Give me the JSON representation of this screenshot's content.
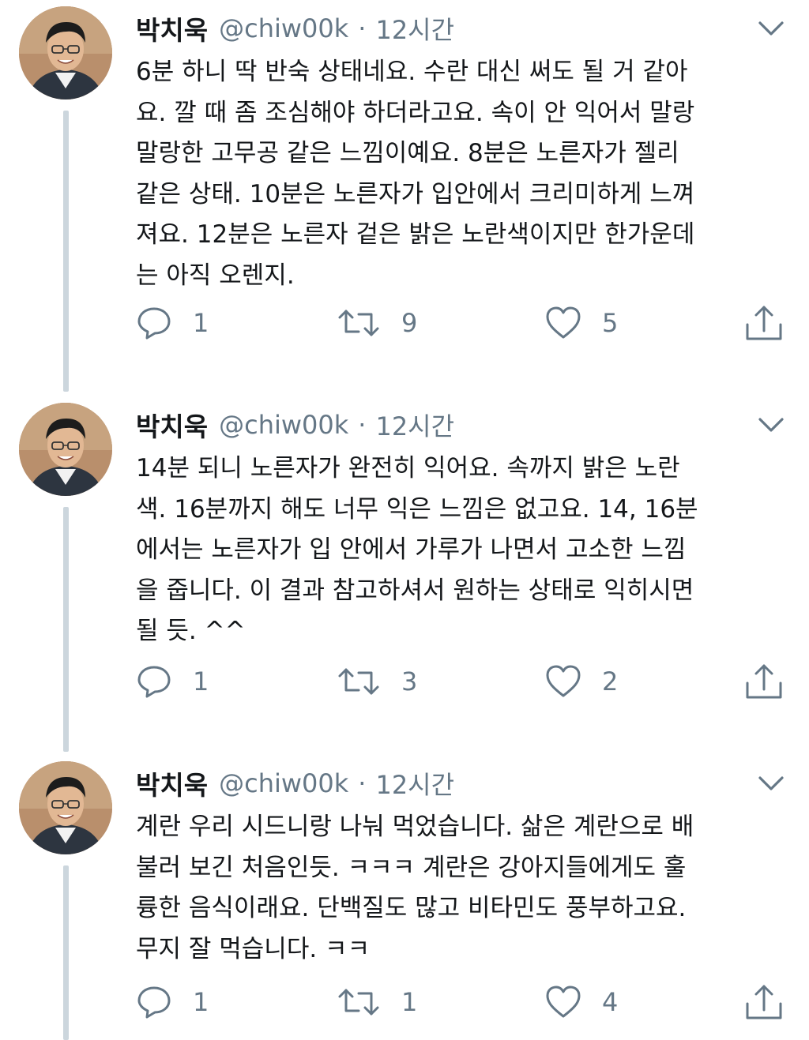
{
  "tweets": [
    {
      "author_name": "박치욱",
      "handle": "@chiw00k",
      "separator": "·",
      "time": "12시간",
      "text": "6분 하니 딱 반숙 상태네요. 수란 대신 써도 될 거 같아\n요. 깔 때 좀 조심해야 하더라고요. 속이 안 익어서 말랑\n말랑한 고무공 같은 느낌이예요. 8분은 노른자가 젤리\n같은 상태. 10분은 노른자가 입안에서 크리미하게 느껴\n져요. 12분은 노른자 겉은 밝은 노란색이지만 한가운데\n는 아직 오렌지.",
      "replies": "1",
      "retweets": "9",
      "likes": "5"
    },
    {
      "author_name": "박치욱",
      "handle": "@chiw00k",
      "separator": "·",
      "time": "12시간",
      "text": "14분 되니 노른자가 완전히 익어요. 속까지 밝은 노란\n색. 16분까지 해도 너무 익은 느낌은 없고요. 14, 16분\n에서는 노른자가 입 안에서 가루가 나면서 고소한 느낌\n을 줍니다. 이 결과 참고하셔서 원하는 상태로 익히시면\n될 듯. ^^",
      "replies": "1",
      "retweets": "3",
      "likes": "2"
    },
    {
      "author_name": "박치욱",
      "handle": "@chiw00k",
      "separator": "·",
      "time": "12시간",
      "text": "계란 우리 시드니랑 나눠 먹었습니다. 삶은 계란으로 배\n불러 보긴 처음인듯. ㅋㅋㅋ 계란은 강아지들에게도 훌\n륭한 음식이래요. 단백질도 많고 비타민도 풍부하고요.\n무지 잘 먹습니다. ㅋㅋ",
      "replies": "1",
      "retweets": "1",
      "likes": "4"
    }
  ],
  "icons": {
    "reply": "reply-icon",
    "retweet": "retweet-icon",
    "like": "like-icon",
    "share": "share-icon",
    "more": "chevron-down-icon"
  },
  "colors": {
    "text": "#14171a",
    "secondary": "#657786",
    "thread_line": "#ccd6dd",
    "background": "#ffffff"
  }
}
